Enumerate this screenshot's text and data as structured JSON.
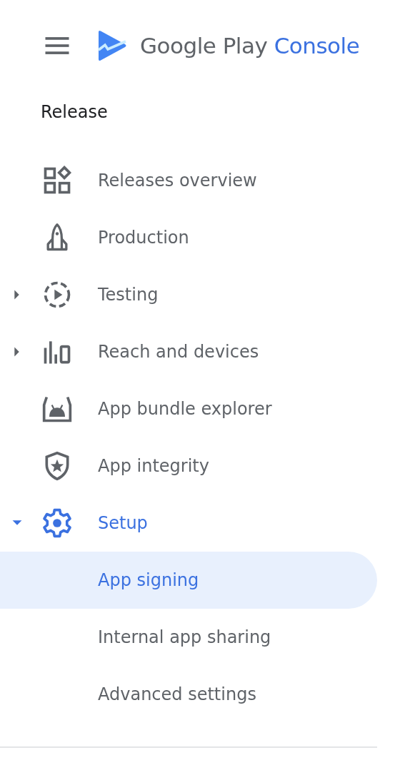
{
  "header": {
    "brand": "Google Play",
    "product": "Console"
  },
  "section": {
    "title": "Release"
  },
  "items": [
    {
      "label": "Releases overview",
      "kind": "overview"
    },
    {
      "label": "Production",
      "kind": "rocket"
    },
    {
      "label": "Testing",
      "kind": "testing",
      "expanded": false
    },
    {
      "label": "Reach and devices",
      "kind": "bars",
      "expanded": false
    },
    {
      "label": "App bundle explorer",
      "kind": "bundle"
    },
    {
      "label": "App integrity",
      "kind": "shield"
    },
    {
      "label": "Setup",
      "kind": "gear",
      "expanded": true,
      "children": [
        {
          "label": "App signing",
          "selected": true
        },
        {
          "label": "Internal app sharing",
          "selected": false
        },
        {
          "label": "Advanced settings",
          "selected": false
        }
      ]
    }
  ]
}
